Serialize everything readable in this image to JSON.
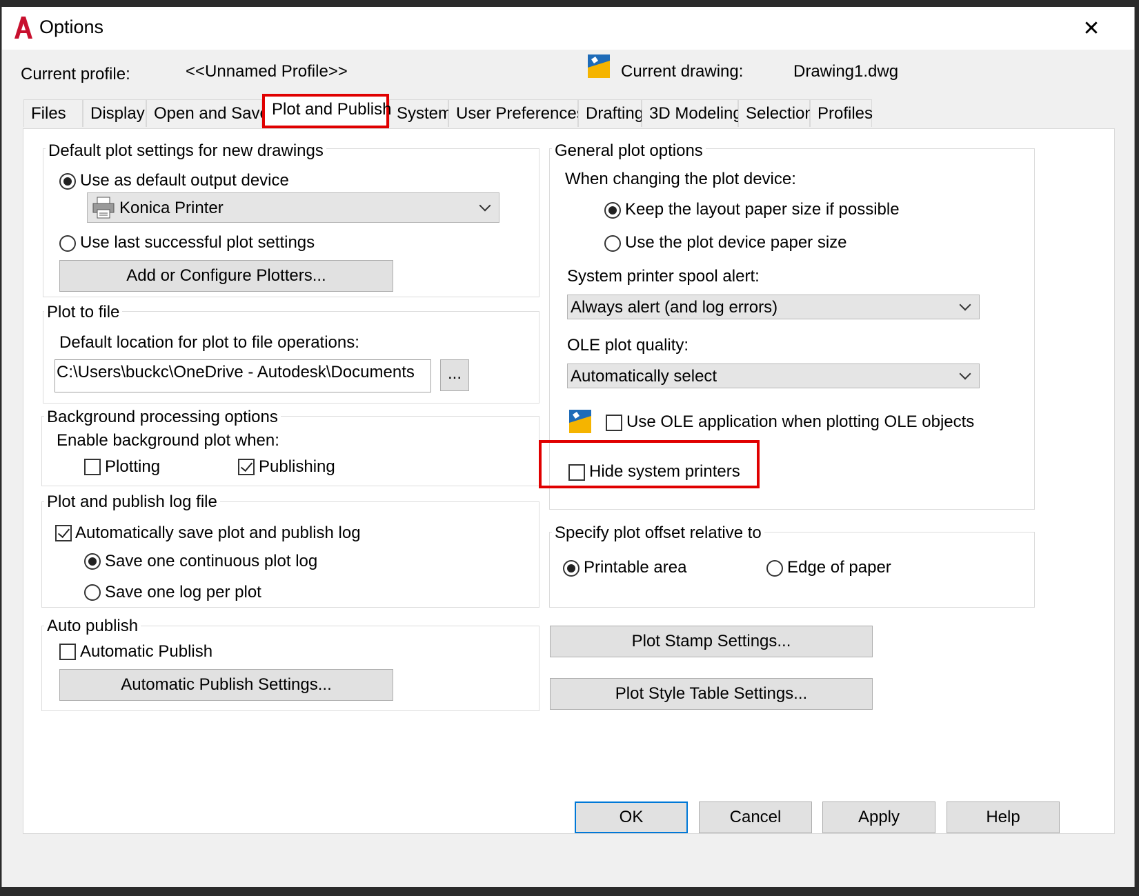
{
  "window": {
    "title": "Options",
    "close_glyph": "✕",
    "app_icon_letter": "A"
  },
  "profile": {
    "current_profile_label": "Current profile:",
    "current_profile_value": "<<Unnamed Profile>>",
    "current_drawing_label": "Current drawing:",
    "current_drawing_value": "Drawing1.dwg"
  },
  "tabs": [
    {
      "label": "Files"
    },
    {
      "label": "Display"
    },
    {
      "label": "Open and Save"
    },
    {
      "label": "Plot and Publish",
      "active": true
    },
    {
      "label": "System"
    },
    {
      "label": "User Preferences"
    },
    {
      "label": "Drafting"
    },
    {
      "label": "3D Modeling"
    },
    {
      "label": "Selection"
    },
    {
      "label": "Profiles"
    }
  ],
  "default_plot": {
    "title": "Default plot settings for new drawings",
    "use_default_label": "Use as default output device",
    "use_default_selected": true,
    "device_value": "Konica Printer",
    "use_last_label": "Use last successful plot settings",
    "use_last_selected": false,
    "add_plotters_button": "Add or Configure Plotters..."
  },
  "plot_to_file": {
    "title": "Plot to file",
    "location_label": "Default location for plot to file operations:",
    "location_value": "C:\\Users\\buckc\\OneDrive - Autodesk\\Documents",
    "browse_button": "..."
  },
  "background": {
    "title": "Background processing options",
    "enable_label": "Enable background plot when:",
    "plotting_label": "Plotting",
    "plotting_checked": false,
    "publishing_label": "Publishing",
    "publishing_checked": true
  },
  "log_file": {
    "title": "Plot and publish log file",
    "auto_save_label": "Automatically save plot and publish log",
    "auto_save_checked": true,
    "continuous_label": "Save one continuous plot log",
    "continuous_selected": true,
    "per_plot_label": "Save one log per plot",
    "per_plot_selected": false
  },
  "auto_publish": {
    "title": "Auto publish",
    "automatic_label": "Automatic Publish",
    "automatic_checked": false,
    "settings_button": "Automatic Publish Settings..."
  },
  "general": {
    "title": "General plot options",
    "changing_label": "When changing the plot device:",
    "keep_layout_label": "Keep the layout paper size if possible",
    "keep_layout_selected": true,
    "use_device_label": "Use the plot device paper size",
    "use_device_selected": false,
    "spool_label": "System printer spool alert:",
    "spool_value": "Always alert (and log errors)",
    "ole_quality_label": "OLE plot quality:",
    "ole_quality_value": "Automatically select",
    "use_ole_label": "Use OLE application when plotting OLE objects",
    "use_ole_checked": false,
    "hide_printers_label": "Hide system printers",
    "hide_printers_checked": false
  },
  "offset": {
    "title": "Specify plot offset relative to",
    "printable_label": "Printable area",
    "printable_selected": true,
    "edge_label": "Edge of paper",
    "edge_selected": false
  },
  "side_buttons": {
    "plot_stamp": "Plot Stamp Settings...",
    "plot_style": "Plot Style Table Settings..."
  },
  "footer": {
    "ok": "OK",
    "cancel": "Cancel",
    "apply": "Apply",
    "help": "Help"
  },
  "colors": {
    "highlight_red": "#e00000",
    "default_button_border": "#0078d7",
    "app_icon_red": "#c8102e"
  },
  "icons": {
    "app": "autocad-logo-icon",
    "drawing": "drawing-file-icon",
    "printer": "printer-icon",
    "ole": "ole-object-icon"
  }
}
